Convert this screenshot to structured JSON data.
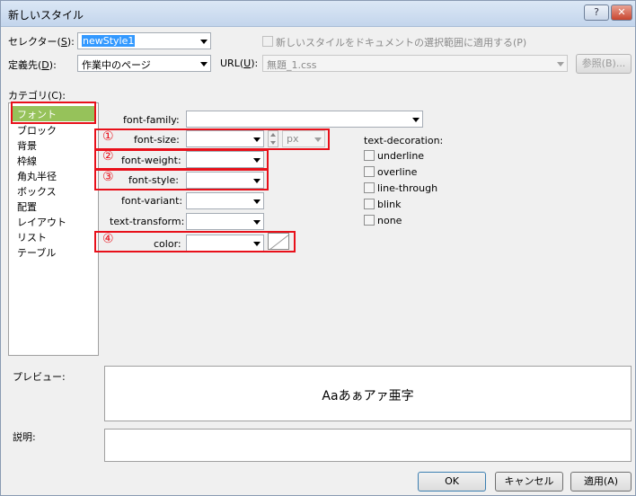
{
  "window": {
    "title": "新しいスタイル",
    "help_label": "?",
    "close_label": "✕"
  },
  "selector": {
    "label_prefix": "セレクター(",
    "label_key": "S",
    "label_suffix": "):",
    "value": "newStyle1",
    "apply_checkbox_label": "新しいスタイルをドキュメントの選択範囲に適用する(P)",
    "apply_checked": false
  },
  "define_in": {
    "label_prefix": "定義先(",
    "label_key": "D",
    "label_suffix": "):",
    "value": "作業中のページ",
    "url_label_prefix": "URL(",
    "url_label_key": "U",
    "url_label_suffix": "):",
    "url_value": "無題_1.css",
    "browse_label": "参照(B)..."
  },
  "category": {
    "label": "カテゴリ(C):",
    "items": [
      "フォント",
      "ブロック",
      "背景",
      "枠線",
      "角丸半径",
      "ボックス",
      "配置",
      "レイアウト",
      "リスト",
      "テーブル"
    ],
    "selected": "フォント"
  },
  "font": {
    "family_label": "font-family:",
    "size_label": "font-size:",
    "size_unit": "px",
    "weight_label": "font-weight:",
    "style_label": "font-style:",
    "variant_label": "font-variant:",
    "transform_label": "text-transform:",
    "color_label": "color:"
  },
  "annotations": [
    "①",
    "②",
    "③",
    "④"
  ],
  "text_decoration": {
    "label": "text-decoration:",
    "options": [
      "underline",
      "overline",
      "line-through",
      "blink",
      "none"
    ]
  },
  "preview": {
    "label": "プレビュー:",
    "sample": "Aaあぁアァ亜字"
  },
  "description": {
    "label": "説明:"
  },
  "buttons": {
    "ok": "OK",
    "cancel": "キャンセル",
    "apply": "適用(A)"
  },
  "colors": {
    "annotation_red": "#e8101a",
    "selected_category_bg": "#96c25a",
    "selection_blue": "#3399ff"
  }
}
